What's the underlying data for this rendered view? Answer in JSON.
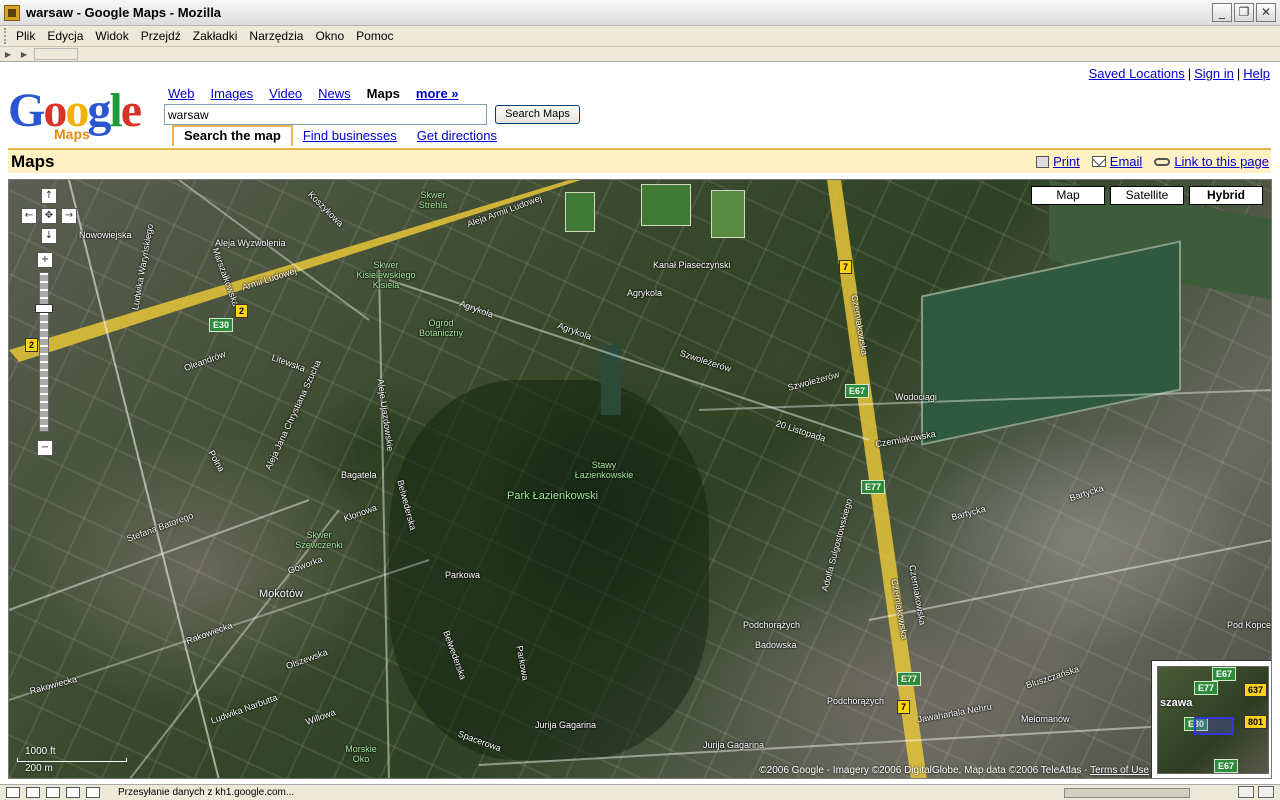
{
  "window": {
    "title": "warsaw - Google Maps - Mozilla",
    "minimize": "_",
    "restore": "❐",
    "close": "✕"
  },
  "menu": [
    "Plik",
    "Edycja",
    "Widok",
    "Przejdź",
    "Zakładki",
    "Narzędzia",
    "Okno",
    "Pomoc"
  ],
  "toplinks": {
    "saved": "Saved Locations",
    "signin": "Sign in",
    "help": "Help",
    "sep": "|"
  },
  "logo": {
    "word": "Google",
    "sub": "Maps",
    "tm": "TM"
  },
  "searchnav": [
    "Web",
    "Images",
    "Video",
    "News",
    "Maps",
    "more »"
  ],
  "search": {
    "value": "warsaw",
    "button": "Search Maps"
  },
  "subtabs": {
    "active": "Search the map",
    "find": "Find businesses",
    "directions": "Get directions"
  },
  "mapsbar": {
    "title": "Maps",
    "print": "Print",
    "email": "Email",
    "link": "Link to this page"
  },
  "maptypes": [
    "Map",
    "Satellite",
    "Hybrid"
  ],
  "map": {
    "labels": {
      "skwer_strehla": "Skwer Strehla",
      "aleja_armii": "Aleja Armii Ludowej",
      "armii_ludowej": "Armii Ludowej",
      "skwer_kisielewskiego": "Skwer Kisielewskiego Kisiela",
      "ogrod_botaniczny": "Ogród Botaniczny",
      "kanal": "Kanał Piaseczyński",
      "agrykola": "Agrykola",
      "agrykola2": "Agrykola",
      "agrykola3": "Agrykola",
      "czerniakowska": "Czerniakowska",
      "czerniakowska2": "Czerniakowska",
      "czerniakowska3": "Czerniakowska",
      "czerniakowska4": "Czerniakowska",
      "szwolezerow": "Szwoleżerów",
      "szwolezerow2": "Szwoleżerów",
      "wodociagi": "Wodociągi",
      "dwudziestego": "20 Listopada",
      "stawy": "Stawy Łazienkowskie",
      "park": "Park Łazienkowski",
      "bagatela": "Bagatela",
      "klonowa": "Klonowa",
      "belwederska": "Belwederska",
      "belwederska2": "Belwederska",
      "skwer_szewczenki": "Skwer Szewczenki",
      "mokotow": "Mokotów",
      "parkowa": "Parkowa",
      "parkowa2": "Parkowa",
      "podchorazych": "Podchorążych",
      "podchorazych2": "Podchorążych",
      "badowska": "Badowska",
      "jurija_gagarina": "Jurija Gagarina",
      "jurija_gagarina2": "Jurija Gagarina",
      "bartycka": "Bartycka",
      "bartycka2": "Bartycka",
      "bluszczanska": "Bluszczańska",
      "stefana_batorego": "Stefana Batorego",
      "rakowiecka": "Rakowiecka",
      "rakowiecka2": "Rakowiecka",
      "ludwika_narbutta": "Ludwika Narbutta",
      "olszewska": "Olszewska",
      "willowa": "Willowa",
      "morskie_oko": "Morskie Oko",
      "spacerowa": "Spacerowa",
      "nowowiejska": "Nowowiejska",
      "aleja_wyzwolenia": "Aleja Wyzwolenia",
      "ludwika_warynskiego": "Ludwika Waryńskiego",
      "oleandrow": "Oleandrów",
      "litewska": "Litewska",
      "jawaharlala": "Jawaharlala Nehru",
      "melomanow": "Melomanów",
      "pod_kopcem": "Pod Kopcem",
      "goworka": "Goworka",
      "sobieskiego": "Adolfa Sulgostowskiego",
      "aleja_ujazdowskie": "Aleje Ujazdowskie",
      "aleja_szucha": "Aleja Jana Chrystiana Szucha",
      "koszykowa": "Koszykowa",
      "polna": "Polna",
      "marszalkowska": "Marszałkowska"
    },
    "shields": {
      "s2a": "2",
      "s2b": "2",
      "s7": "7",
      "s7b": "7",
      "e30": "E30",
      "e67": "E67",
      "e77": "E77",
      "e77b": "E77"
    },
    "scale_ft": "1000 ft",
    "scale_m": "200 m",
    "copyright": "©2006 Google - Imagery ©2006 DigitalGlobe, Map data ©2006 TeleAtlas -",
    "terms": "Terms of Use",
    "overview": {
      "city": "szawa",
      "e67": "E67",
      "e77": "E77",
      "s637": "637",
      "s801": "801",
      "e30": "E30",
      "e67b": "E67"
    }
  },
  "status": {
    "text": "Przesyłanie danych z kh1.google.com..."
  }
}
